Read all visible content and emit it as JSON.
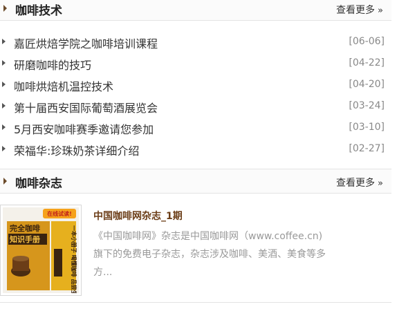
{
  "coffee_tech": {
    "title": "咖啡技术",
    "more": "查看更多",
    "items": [
      {
        "text": "嘉匠烘焙学院之咖啡培训课程",
        "date": "[06-06]"
      },
      {
        "text": "研磨咖啡的技巧",
        "date": "[04-22]"
      },
      {
        "text": "咖啡烘焙机温控技术",
        "date": "[04-20]"
      },
      {
        "text": "第十届西安国际葡萄酒展览会",
        "date": "[03-24]"
      },
      {
        "text": "5月西安咖啡赛季邀请您参加",
        "date": "[03-10]"
      },
      {
        "text": "荣福华:珍珠奶茶详细介绍",
        "date": "[02-27]"
      }
    ]
  },
  "coffee_magazine": {
    "title": "咖啡杂志",
    "more": "查看更多",
    "item_title": "中国咖啡网杂志_1期",
    "description": "《中国咖啡网》杂志是中国咖啡网（www.coffee.cn)旗下的免费电子杂志，杂志涉及咖啡、美酒、美食等多方...",
    "cover": {
      "badge": "在线试读!",
      "title_line1": "完全咖啡",
      "title_line2": "知识手册",
      "side_text": "一本小册子 喝懂咖啡 品尝生活"
    }
  },
  "colors": {
    "accent_brown": "#6b3d17",
    "header_bg": "#fbfbfb",
    "date_gray": "#888888"
  }
}
